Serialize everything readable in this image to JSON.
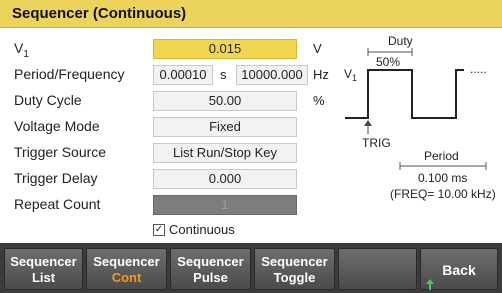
{
  "title": "Sequencer (Continuous)",
  "rows": {
    "v1": {
      "label_main": "V",
      "label_sub": "1",
      "value": "0.015",
      "unit": "V"
    },
    "period": {
      "label": "Period/Frequency",
      "period_value": "0.00010",
      "period_unit": "s",
      "freq_value": "10000.000",
      "freq_unit": "Hz"
    },
    "duty": {
      "label": "Duty Cycle",
      "value": "50.00",
      "unit": "%"
    },
    "voltage_mode": {
      "label": "Voltage Mode",
      "value": "Fixed"
    },
    "trigger_source": {
      "label": "Trigger Source",
      "value": "List Run/Stop Key"
    },
    "trigger_delay": {
      "label": "Trigger Delay",
      "value": "0.000"
    },
    "repeat_count": {
      "label": "Repeat Count",
      "value": "1"
    }
  },
  "continuous": {
    "label": "Continuous",
    "checked": true,
    "mark": "✓"
  },
  "diagram": {
    "duty_label": "Duty",
    "duty_percent": "50%",
    "v1_main": "V",
    "v1_sub": "1",
    "trig_label": "TRIG",
    "period_label": "Period",
    "period_value": "0.100 ms",
    "freq_text": "(FREQ= 10.00 kHz)",
    "dots": "....."
  },
  "softkeys": [
    {
      "line1": "Sequencer",
      "line2": "List",
      "selected": false
    },
    {
      "line1": "Sequencer",
      "line2": "Cont",
      "selected": true
    },
    {
      "line1": "Sequencer",
      "line2": "Pulse",
      "selected": false
    },
    {
      "line1": "Sequencer",
      "line2": "Toggle",
      "selected": false
    },
    {
      "line1": "",
      "line2": "",
      "selected": false
    },
    {
      "line1": "Back",
      "line2": "",
      "selected": false
    }
  ],
  "colors": {
    "title_bar": "#ecd35b",
    "active_field": "#f1d74f",
    "selected_softkey_text": "#f39a1d",
    "softkey_bg": "#5a5a5a"
  }
}
